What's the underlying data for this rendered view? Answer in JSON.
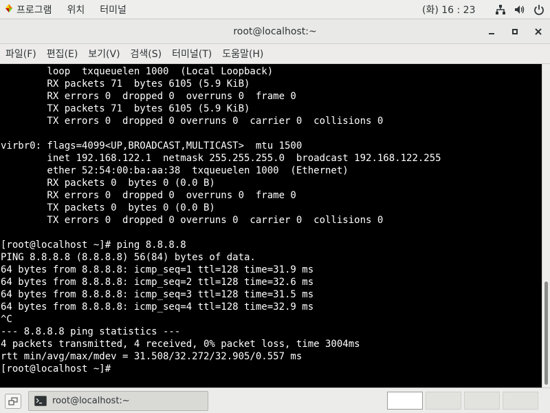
{
  "topbar": {
    "apps_label": "프로그램",
    "places_label": "위치",
    "terminal_label": "터미널",
    "clock": "(화) 16 : 23"
  },
  "window": {
    "title": "root@localhost:~"
  },
  "menubar": {
    "items": [
      "파일(F)",
      "편집(E)",
      "보기(V)",
      "검색(S)",
      "터미널(T)",
      "도움말(H)"
    ]
  },
  "terminal": {
    "lines": [
      "        loop  txqueuelen 1000  (Local Loopback)",
      "        RX packets 71  bytes 6105 (5.9 KiB)",
      "        RX errors 0  dropped 0  overruns 0  frame 0",
      "        TX packets 71  bytes 6105 (5.9 KiB)",
      "        TX errors 0  dropped 0 overruns 0  carrier 0  collisions 0",
      "",
      "virbr0: flags=4099<UP,BROADCAST,MULTICAST>  mtu 1500",
      "        inet 192.168.122.1  netmask 255.255.255.0  broadcast 192.168.122.255",
      "        ether 52:54:00:ba:aa:38  txqueuelen 1000  (Ethernet)",
      "        RX packets 0  bytes 0 (0.0 B)",
      "        RX errors 0  dropped 0  overruns 0  frame 0",
      "        TX packets 0  bytes 0 (0.0 B)",
      "        TX errors 0  dropped 0 overruns 0  carrier 0  collisions 0",
      "",
      "[root@localhost ~]# ping 8.8.8.8",
      "PING 8.8.8.8 (8.8.8.8) 56(84) bytes of data.",
      "64 bytes from 8.8.8.8: icmp_seq=1 ttl=128 time=31.9 ms",
      "64 bytes from 8.8.8.8: icmp_seq=2 ttl=128 time=32.6 ms",
      "64 bytes from 8.8.8.8: icmp_seq=3 ttl=128 time=31.5 ms",
      "64 bytes from 8.8.8.8: icmp_seq=4 ttl=128 time=32.9 ms",
      "^C",
      "--- 8.8.8.8 ping statistics ---",
      "4 packets transmitted, 4 received, 0% packet loss, time 3004ms",
      "rtt min/avg/max/mdev = 31.508/32.272/32.905/0.557 ms",
      "[root@localhost ~]# "
    ]
  },
  "taskbar": {
    "task_label": "root@localhost:~",
    "workspaces": [
      true,
      false,
      false,
      false
    ]
  },
  "icons": {
    "apps": "apps-menu-icon",
    "network": "network-wired-icon",
    "volume": "volume-icon",
    "power": "power-icon",
    "minimize": "minimize-icon",
    "maximize": "maximize-icon",
    "close": "close-icon",
    "show_desktop": "show-desktop-icon",
    "terminal": "terminal-icon"
  },
  "colors": {
    "terminal_bg": "#000000",
    "terminal_fg": "#ffffff",
    "panel_bg": "#eeeeec"
  }
}
